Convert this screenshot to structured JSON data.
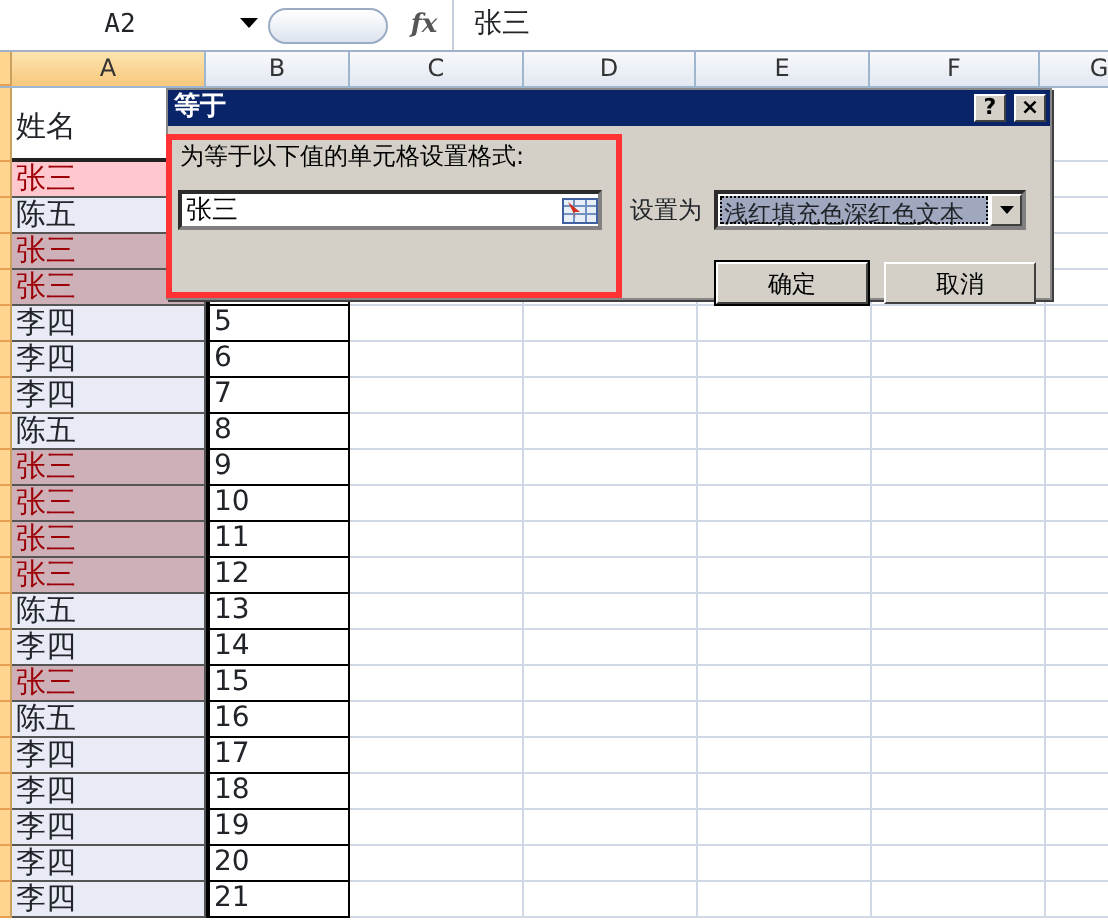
{
  "formula_bar": {
    "name_box": "A2",
    "fx": "fx",
    "content": "张三"
  },
  "column_headers": [
    {
      "label": "A",
      "selected": true
    },
    {
      "label": "B",
      "selected": false
    },
    {
      "label": "C",
      "selected": false
    },
    {
      "label": "D",
      "selected": false
    },
    {
      "label": "E",
      "selected": false
    },
    {
      "label": "F",
      "selected": false
    },
    {
      "label": "G",
      "selected": false
    }
  ],
  "header_cell": "姓名",
  "rows": [
    {
      "name": "张三",
      "value": "",
      "highlighted": true,
      "active": true
    },
    {
      "name": "陈五",
      "value": "",
      "highlighted": false,
      "active": false
    },
    {
      "name": "张三",
      "value": "",
      "highlighted": true,
      "active": false
    },
    {
      "name": "张三",
      "value": "",
      "highlighted": true,
      "active": false
    },
    {
      "name": "李四",
      "value": "5",
      "highlighted": false,
      "active": false
    },
    {
      "name": "李四",
      "value": "6",
      "highlighted": false,
      "active": false
    },
    {
      "name": "李四",
      "value": "7",
      "highlighted": false,
      "active": false
    },
    {
      "name": "陈五",
      "value": "8",
      "highlighted": false,
      "active": false
    },
    {
      "name": "张三",
      "value": "9",
      "highlighted": true,
      "active": false
    },
    {
      "name": "张三",
      "value": "10",
      "highlighted": true,
      "active": false
    },
    {
      "name": "张三",
      "value": "11",
      "highlighted": true,
      "active": false
    },
    {
      "name": "张三",
      "value": "12",
      "highlighted": true,
      "active": false
    },
    {
      "name": "陈五",
      "value": "13",
      "highlighted": false,
      "active": false
    },
    {
      "name": "李四",
      "value": "14",
      "highlighted": false,
      "active": false
    },
    {
      "name": "张三",
      "value": "15",
      "highlighted": true,
      "active": false
    },
    {
      "name": "陈五",
      "value": "16",
      "highlighted": false,
      "active": false
    },
    {
      "name": "李四",
      "value": "17",
      "highlighted": false,
      "active": false
    },
    {
      "name": "李四",
      "value": "18",
      "highlighted": false,
      "active": false
    },
    {
      "name": "李四",
      "value": "19",
      "highlighted": false,
      "active": false
    },
    {
      "name": "李四",
      "value": "20",
      "highlighted": false,
      "active": false
    },
    {
      "name": "李四",
      "value": "21",
      "highlighted": false,
      "active": false
    }
  ],
  "dialog": {
    "title": "等于",
    "help_button": "?",
    "close_button": "×",
    "instruction": "为等于以下值的单元格设置格式:",
    "value": "张三",
    "format_label": "设置为",
    "format_value": "浅红填充色深红色文本",
    "buttons": [
      {
        "label": "确定",
        "default": true
      },
      {
        "label": "取消",
        "default": false
      }
    ]
  }
}
